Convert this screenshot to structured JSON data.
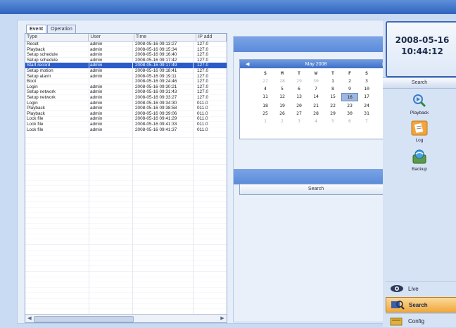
{
  "tabs": [
    {
      "label": "Event",
      "active": true
    },
    {
      "label": "Operation",
      "active": false
    }
  ],
  "log_table": {
    "columns": [
      "Type",
      "User",
      "Time",
      "IP add"
    ],
    "rows": [
      [
        "Reset",
        "admin",
        "2008-05-16 09:13:27",
        "127.0"
      ],
      [
        "Playback",
        "admin",
        "2008-05-16 09:15:34",
        "127.0"
      ],
      [
        "Setup schedule",
        "admin",
        "2008-05-16 09:16:40",
        "127.0"
      ],
      [
        "Setup schedule",
        "admin",
        "2008-05-16 09:17:42",
        "127.0"
      ],
      [
        "Start record",
        "admin",
        "2008-05-16 09:17:49",
        "127.0"
      ],
      [
        "Setup motion",
        "admin",
        "2008-05-16 09:18:41",
        "127.0"
      ],
      [
        "Setup alarm",
        "admin",
        "2008-05-16 09:19:11",
        "127.0"
      ],
      [
        "Boot",
        "",
        "2008-05-16 09:24:46",
        "127.0"
      ],
      [
        "Login",
        "admin",
        "2008-05-16 09:30:21",
        "127.0"
      ],
      [
        "Setup network",
        "admin",
        "2008-05-16 09:31:43",
        "127.0"
      ],
      [
        "Setup network",
        "admin",
        "2008-05-16 09:33:27",
        "127.0"
      ],
      [
        "Login",
        "admin",
        "2008-05-16 09:34:30",
        "011.0"
      ],
      [
        "Playback",
        "admin",
        "2008-05-16 09:38:58",
        "011.0"
      ],
      [
        "Playback",
        "admin",
        "2008-05-16 09:39:06",
        "011.0"
      ],
      [
        "Lock file",
        "admin",
        "2008-05-16 09:41:29",
        "011.0"
      ],
      [
        "Lock file",
        "admin",
        "2008-05-16 09:41:33",
        "011.0"
      ],
      [
        "Lock file",
        "admin",
        "2008-05-16 09:41:37",
        "011.0"
      ]
    ],
    "selected_row": 4
  },
  "calendar": {
    "month_label": "May 2008",
    "weekdays": [
      "S",
      "M",
      "T",
      "W",
      "T",
      "F",
      "S"
    ],
    "days": [
      [
        "27",
        "28",
        "29",
        "30",
        "1",
        "2",
        "3"
      ],
      [
        "4",
        "5",
        "6",
        "7",
        "8",
        "9",
        "10"
      ],
      [
        "11",
        "12",
        "13",
        "14",
        "15",
        "16",
        "17"
      ],
      [
        "18",
        "19",
        "20",
        "21",
        "22",
        "23",
        "24"
      ],
      [
        "25",
        "26",
        "27",
        "28",
        "29",
        "30",
        "31"
      ],
      [
        "1",
        "2",
        "3",
        "4",
        "5",
        "6",
        "7"
      ]
    ],
    "dim_days": [
      [
        0,
        0
      ],
      [
        0,
        1
      ],
      [
        0,
        2
      ],
      [
        0,
        3
      ],
      [
        5,
        0
      ],
      [
        5,
        1
      ],
      [
        5,
        2
      ],
      [
        5,
        3
      ],
      [
        5,
        4
      ],
      [
        5,
        5
      ],
      [
        5,
        6
      ]
    ],
    "selected": [
      2,
      5
    ]
  },
  "search_button": "Search",
  "clock": {
    "date": "2008-05-16",
    "time": "10:44:12"
  },
  "sidebar": {
    "header": "Search",
    "items": [
      {
        "label": "Playback",
        "icon": "playback-icon"
      },
      {
        "label": "Log",
        "icon": "log-icon",
        "active": true
      },
      {
        "label": "Backup",
        "icon": "backup-icon"
      }
    ]
  },
  "nav": [
    {
      "label": "Live",
      "icon": "eye-icon"
    },
    {
      "label": "Search",
      "icon": "search-icon",
      "active": true
    },
    {
      "label": "Config",
      "icon": "config-icon"
    }
  ],
  "colors": {
    "selection": "#2a5bc9",
    "accent": "#5b8ad9",
    "nav_active": "#f0a93e"
  }
}
